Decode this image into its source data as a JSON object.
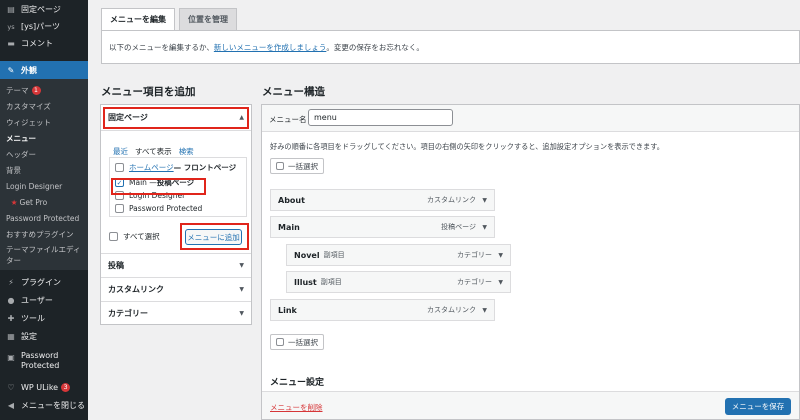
{
  "sidebar": {
    "top_items": [
      {
        "label": "固定ページ",
        "icon": "page-icon"
      },
      {
        "label": "[ys]パーツ",
        "icon": "ys-icon"
      },
      {
        "label": "コメント",
        "icon": "comment-icon"
      }
    ],
    "active_item": {
      "label": "外観",
      "icon": "brush-icon"
    },
    "submenu": {
      "theme": "テーマ",
      "theme_badge": "1",
      "customize": "カスタマイズ",
      "widgets": "ウィジェット",
      "menus": "メニュー",
      "header": "ヘッダー",
      "background": "背景",
      "login_designer": "Login Designer",
      "get_pro": "Get Pro",
      "password_protected": "Password Protected",
      "recommended_plugins": "おすすめプラグイン",
      "theme_file_editor_line1": "テーマファイルエディ",
      "theme_file_editor_line2": "ター"
    },
    "bottom_items": [
      {
        "label": "プラグイン",
        "icon": "plugin-icon"
      },
      {
        "label": "ユーザー",
        "icon": "user-icon"
      },
      {
        "label": "ツール",
        "icon": "tool-icon"
      },
      {
        "label": "設定",
        "icon": "settings-icon"
      }
    ],
    "password_protected_line1": "Password",
    "password_protected_line2": "Protected",
    "wp_ulike": "WP ULike",
    "wp_ulike_badge": "3",
    "collapse": "メニューを閉じる"
  },
  "tabs": [
    "メニューを編集",
    "位置を管理"
  ],
  "notice": {
    "prefix": "以下のメニューを編集するか、",
    "link": "新しいメニューを作成しましょう",
    "suffix": "。変更の保存をお忘れなく。"
  },
  "add_items": {
    "title": "メニュー項目を追加",
    "pages_title": "固定ページ",
    "subtabs": [
      "最近",
      "すべて表示",
      "検索"
    ],
    "pages": {
      "home_link": "ホームページ",
      "home_suffix": " — フロントページ",
      "main_prefix": "Main — ",
      "main_suffix": "投稿ページ",
      "login_designer": "Login Designer",
      "password_protected": "Password Protected"
    },
    "select_all": "すべて選択",
    "add_button": "メニューに追加",
    "sections": [
      "投稿",
      "カスタムリンク",
      "カテゴリー"
    ]
  },
  "structure": {
    "title": "メニュー構造",
    "name_label": "メニュー名",
    "name_value": "menu",
    "description": "好みの順番に各項目をドラッグしてください。項目の右側の矢印をクリックすると、追加設定オプションを表示できます。",
    "bulk_select": "一括選択",
    "items": [
      {
        "title": "About",
        "sub": "",
        "type": "カスタムリンク"
      },
      {
        "title": "Main",
        "sub": "",
        "type": "投稿ページ"
      },
      {
        "title": "Novel",
        "sub": "副項目",
        "type": "カテゴリー"
      },
      {
        "title": "Illust",
        "sub": "副項目",
        "type": "カテゴリー"
      },
      {
        "title": "Link",
        "sub": "",
        "type": "カスタムリンク"
      }
    ],
    "settings_title": "メニュー設定",
    "delete": "メニューを削除",
    "save": "メニューを保存"
  },
  "colors": {
    "accent": "#2271b1",
    "highlight": "#e0251b",
    "sidebar": "#1d2327",
    "danger": "#d63638"
  }
}
